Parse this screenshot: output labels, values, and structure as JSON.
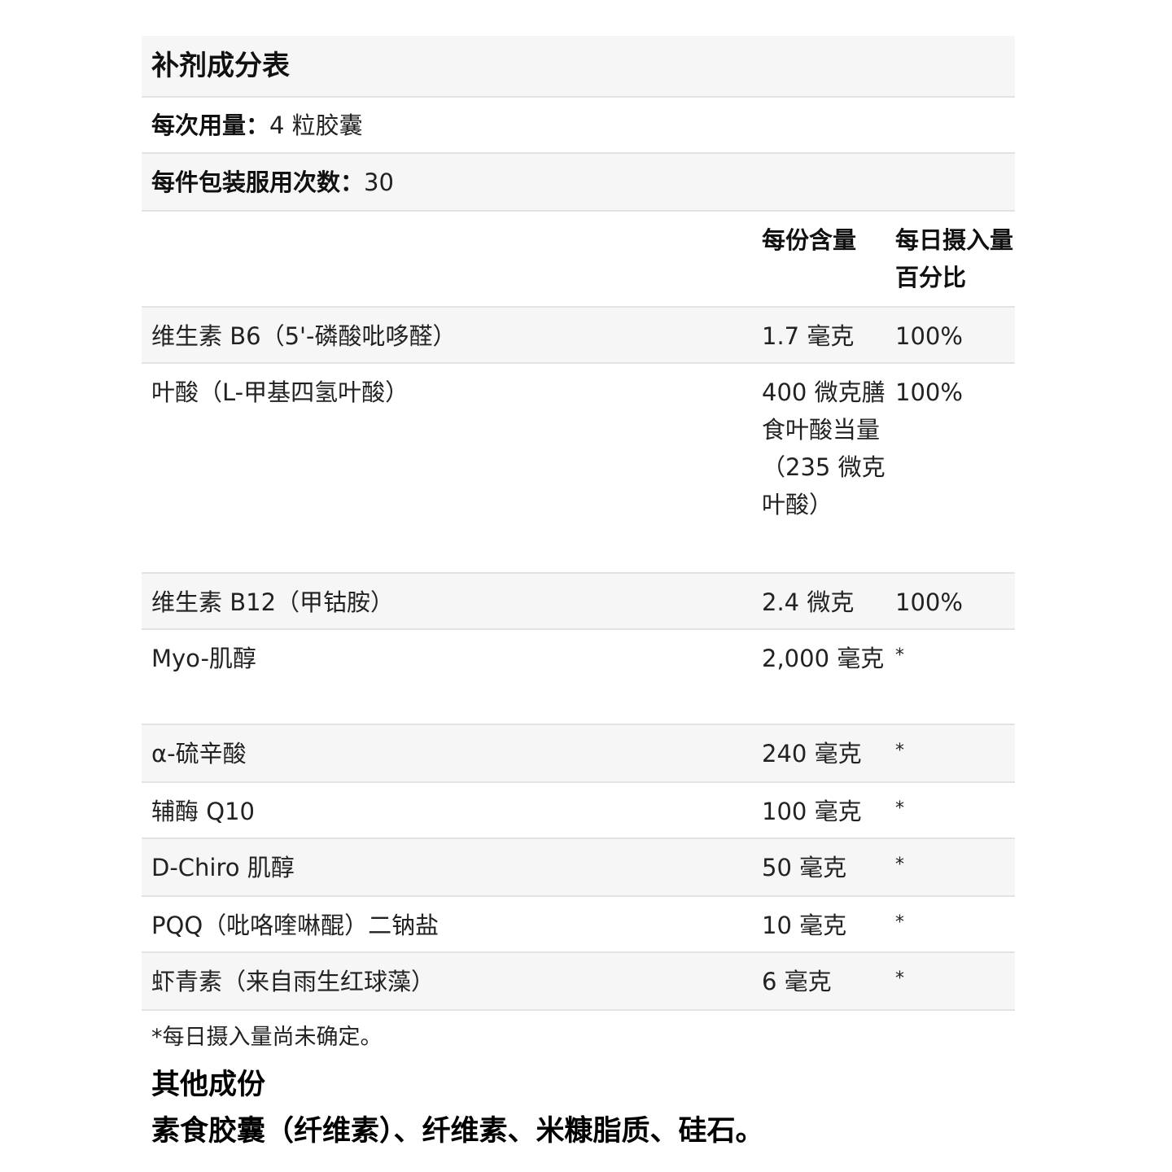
{
  "table": {
    "title": "补剂成分表",
    "serving_size_label": "每次用量：",
    "serving_size_value": "4 粒胶囊",
    "servings_label": "每件包装服用次数：",
    "servings_value": "30",
    "col_amount": "每份含量",
    "col_dv": "每日摄入量百分比",
    "rows": [
      {
        "name": "维生素 B6（5'-磷酸吡哆醛）",
        "amount": "1.7 毫克",
        "dv": "100%"
      },
      {
        "name": "叶酸（L-甲基四氢叶酸）",
        "amount": "400 微克膳食叶酸当量（235 微克叶酸）",
        "dv": "100%"
      },
      {
        "name": "维生素 B12（甲钴胺）",
        "amount": "2.4 微克",
        "dv": "100%"
      },
      {
        "name": "Myo-肌醇",
        "amount": "2,000 毫克",
        "dv": "*"
      },
      {
        "name": "α-硫辛酸",
        "amount": "240 毫克",
        "dv": "*"
      },
      {
        "name": "辅酶 Q10",
        "amount": "100 毫克",
        "dv": "*"
      },
      {
        "name": "D-Chiro 肌醇",
        "amount": "50 毫克",
        "dv": "*"
      },
      {
        "name": "PQQ（吡咯喹啉醌）二钠盐",
        "amount": "10 毫克",
        "dv": "*"
      },
      {
        "name": "虾青素（来自雨生红球藻）",
        "amount": "6 毫克",
        "dv": "*"
      }
    ],
    "footnote": "*每日摄入量尚未确定。"
  },
  "other": {
    "title": "其他成份",
    "body": "素食胶囊（纤维素）、纤维素、米糠脂质、硅石。"
  }
}
